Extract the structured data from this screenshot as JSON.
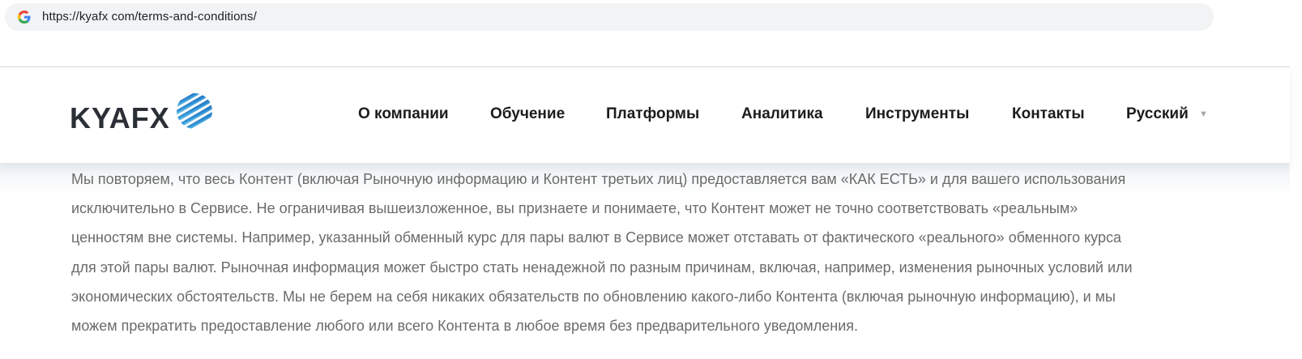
{
  "browser": {
    "url": "https://kyafx com/terms-and-conditions/",
    "favicon_icon": "google-g-icon"
  },
  "header": {
    "logo_text": "KYAFX",
    "logo_icon": "striped-globe-icon",
    "nav": [
      {
        "label": "О компании"
      },
      {
        "label": "Обучение"
      },
      {
        "label": "Платформы"
      },
      {
        "label": "Аналитика"
      },
      {
        "label": "Инструменты"
      },
      {
        "label": "Контакты"
      },
      {
        "label": "Русский"
      }
    ],
    "language_dropdown_icon": "triangle-down-icon"
  },
  "content": {
    "lines": [
      "Мы повторяем, что весь Контент (включая Рыночную информацию и Контент третьих лиц) предоставляется вам «КАК ЕСТЬ» и для вашего использования",
      "исключительно в Сервисе. Не ограничивая вышеизложенное, вы признаете и понимаете, что Контент может не точно соответствовать «реальным»",
      "ценностям вне системы. Например, указанный обменный курс для пары валют в Сервисе может отставать от фактического «реального» обменного курса",
      "для этой пары валют. Рыночная информация может быстро стать ненадежной по разным причинам, включая, например, изменения рыночных условий или",
      "экономических обстоятельств. Мы не берем на себя никаких обязательств по обновлению какого-либо Контента (включая рыночную информацию), и мы",
      "можем прекратить предоставление любого или всего Контента в любое время без предварительного уведомления."
    ]
  },
  "colors": {
    "nav_text": "#1c1c1c",
    "body_text": "#6b6b6b",
    "logo_text": "#2b2f36",
    "logo_blue": "#2e8fd4"
  }
}
